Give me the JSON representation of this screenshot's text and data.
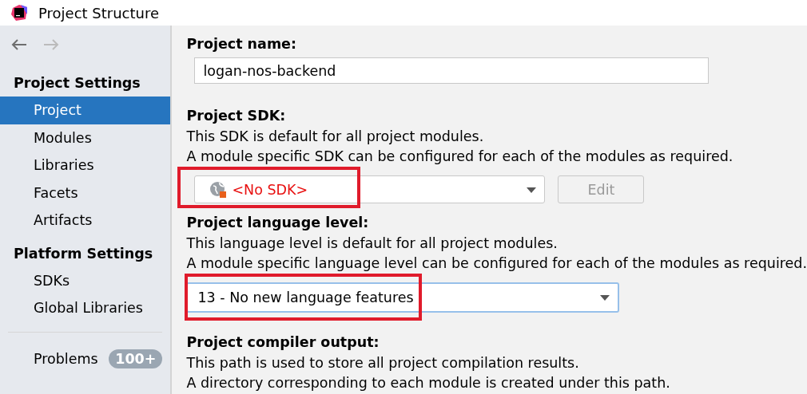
{
  "window": {
    "title": "Project Structure"
  },
  "navigation": {
    "back_disabled": false,
    "forward_disabled": true
  },
  "sidebar": {
    "groups": [
      {
        "heading": "Project Settings",
        "items": [
          {
            "label": "Project",
            "selected": true
          },
          {
            "label": "Modules",
            "selected": false
          },
          {
            "label": "Libraries",
            "selected": false
          },
          {
            "label": "Facets",
            "selected": false
          },
          {
            "label": "Artifacts",
            "selected": false
          }
        ]
      },
      {
        "heading": "Platform Settings",
        "items": [
          {
            "label": "SDKs",
            "selected": false
          },
          {
            "label": "Global Libraries",
            "selected": false
          }
        ]
      }
    ],
    "problems": {
      "label": "Problems",
      "badge": "100+"
    }
  },
  "content": [
    {
      "kind": "text",
      "heading": "Project name:",
      "value": "logan-nos-backend"
    },
    {
      "kind": "sdk",
      "heading": "Project SDK:",
      "lines": [
        "This SDK is default for all project modules.",
        "A module specific SDK can be configured for each of the modules as required."
      ],
      "value": "<No SDK>",
      "highlighted": true,
      "button": {
        "label": "Edit",
        "disabled": true
      }
    },
    {
      "kind": "select",
      "heading": "Project language level:",
      "lines": [
        "This language level is default for all project modules.",
        "A module specific language level can be configured for each of the modules as required."
      ],
      "value": "13 - No new language features",
      "highlighted": true,
      "focused": true
    },
    {
      "kind": "info",
      "heading": "Project compiler output:",
      "lines": [
        "This path is used to store all project compilation results.",
        "A directory corresponding to each module is created under this path."
      ]
    }
  ]
}
